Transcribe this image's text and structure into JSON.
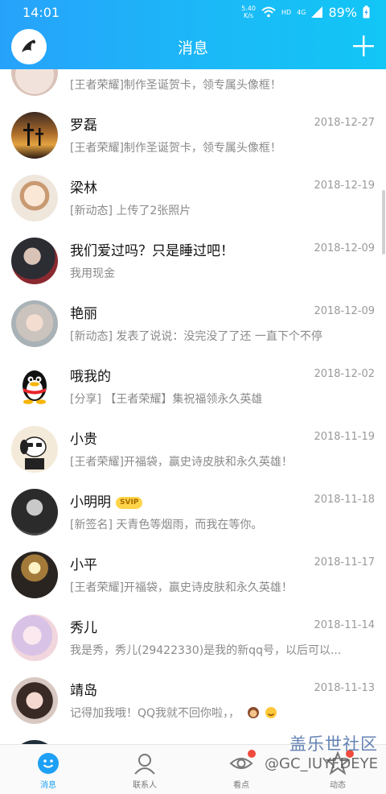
{
  "status_bar": {
    "time": "14:01",
    "net_speed_value": "5.40",
    "net_speed_unit": "K/s",
    "hd": "HD",
    "network": "4G",
    "battery": "89%"
  },
  "header": {
    "title": "消息"
  },
  "conversations": [
    {
      "name": "",
      "date": "",
      "preview": "[王者荣耀]制作圣诞贺卡，领专属头像框！"
    },
    {
      "name": "罗磊",
      "date": "2018-12-27",
      "preview": "[王者荣耀]制作圣诞贺卡，领专属头像框！"
    },
    {
      "name": "梁林",
      "date": "2018-12-19",
      "preview": "[新动态] 上传了2张照片"
    },
    {
      "name": "我们爱过吗？只是睡过吧！",
      "date": "2018-12-09",
      "preview": "我用现金"
    },
    {
      "name": "艳丽",
      "date": "2018-12-09",
      "preview": "[新动态] 发表了说说：没完没了了还  一直下个不停"
    },
    {
      "name": "哦我的",
      "date": "2018-12-02",
      "preview": "[分享] 【王者荣耀】集祝福领永久英雄"
    },
    {
      "name": "小贵",
      "date": "2018-11-19",
      "preview": "[王者荣耀]开福袋，赢史诗皮肤和永久英雄！"
    },
    {
      "name": "小明明",
      "date": "2018-11-18",
      "preview": "[新签名]                  天青色等烟雨，而我在等你。",
      "badge": "SVIP"
    },
    {
      "name": "小平",
      "date": "2018-11-17",
      "preview": "[王者荣耀]开福袋，赢史诗皮肤和永久英雄！"
    },
    {
      "name": "秀儿",
      "date": "2018-11-14",
      "preview": "我是秀，秀儿(29422330)是我的新qq号，以后可以..."
    },
    {
      "name": "靖岛",
      "date": "2018-11-13",
      "preview": "记得加我哦！QQ我就不回你啦，，"
    },
    {
      "name": "❤",
      "date": "",
      "preview": ""
    }
  ],
  "tabbar": {
    "tabs": [
      {
        "label": "消息"
      },
      {
        "label": "联系人"
      },
      {
        "label": "看点"
      },
      {
        "label": "动态"
      }
    ]
  },
  "watermark": {
    "line1": "盖乐世社区",
    "line2": "@GC_IUYFDEYE"
  },
  "colors": {
    "header_start": "#27a2fb",
    "header_end": "#12c6f6",
    "accent": "#1ea0f5",
    "badge_red": "#f04a3c",
    "svip_gold": "#ffd44a"
  },
  "icons": [
    "signal-wifi-icon",
    "battery-icon",
    "app-logo-icon",
    "add-icon",
    "message-tab-icon",
    "contacts-tab-icon",
    "explore-tab-icon",
    "moments-tab-icon"
  ]
}
